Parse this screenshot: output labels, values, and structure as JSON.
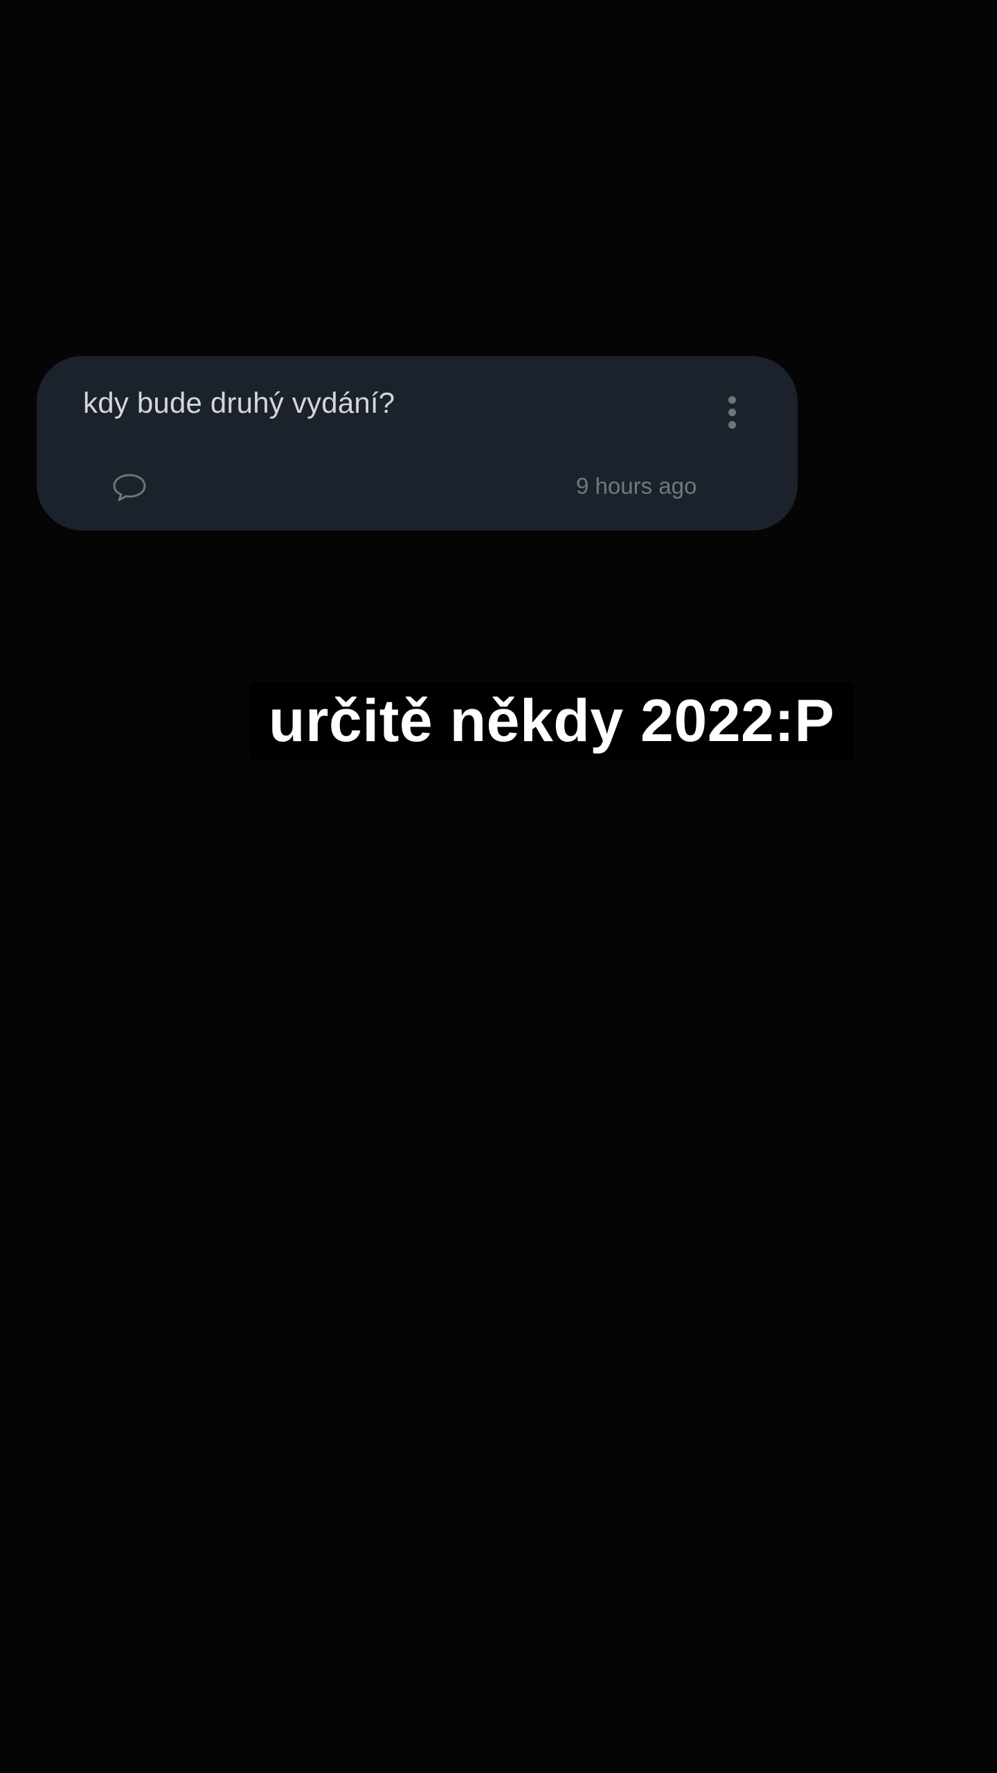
{
  "question_card": {
    "question": "kdy bude druhý vydání?",
    "time_ago": "9 hours ago",
    "icons": {
      "comment": "comment-icon",
      "more": "more-vertical-icon"
    }
  },
  "answer": {
    "text": "určitě někdy 2022:P"
  },
  "colors": {
    "background": "#050505",
    "card": "#1c222c",
    "question_text": "#d3d6da",
    "muted": "#72777f",
    "answer_text": "#ffffff",
    "answer_bg": "#000000"
  }
}
